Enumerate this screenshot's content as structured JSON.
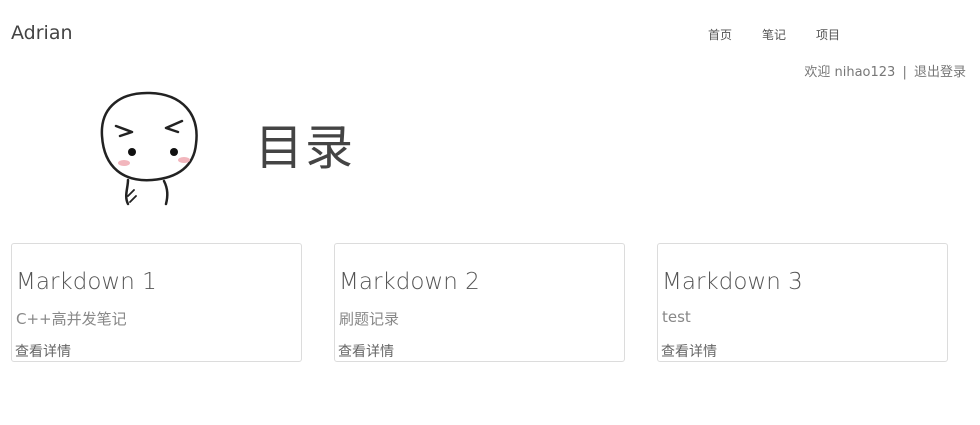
{
  "header": {
    "brand": "Adrian",
    "nav": [
      "首页",
      "笔记",
      "项目"
    ]
  },
  "user": {
    "welcome": "欢迎 nihao123",
    "separator": "|",
    "logout": "退出登录"
  },
  "page": {
    "title": "目录",
    "avatar_icon": "cartoon-face-icon"
  },
  "cards": [
    {
      "title": "Markdown 1",
      "subtitle": "C++高并发笔记",
      "link": "查看详情"
    },
    {
      "title": "Markdown 2",
      "subtitle": "刷题记录",
      "link": "查看详情"
    },
    {
      "title": "Markdown 3",
      "subtitle": "test",
      "link": "查看详情"
    }
  ]
}
